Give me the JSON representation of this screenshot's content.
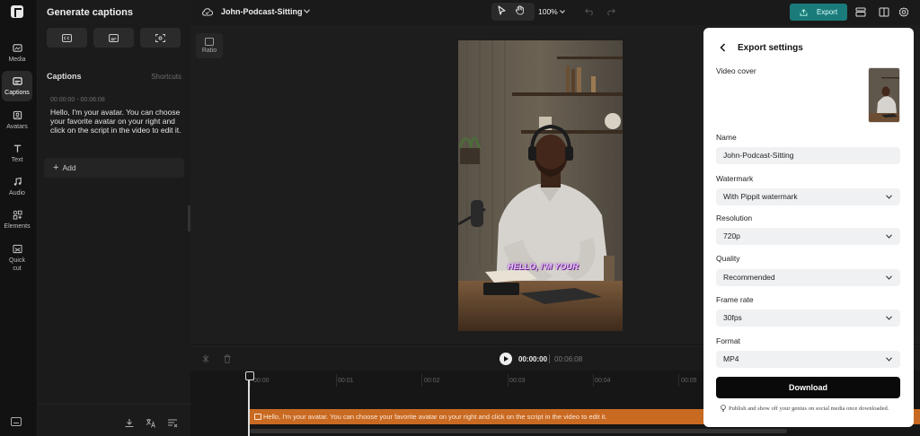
{
  "rail": {
    "items": [
      {
        "label": "Media",
        "icon": "media-icon"
      },
      {
        "label": "Captions",
        "icon": "captions-icon",
        "active": true
      },
      {
        "label": "Avatars",
        "icon": "avatars-icon"
      },
      {
        "label": "Text",
        "icon": "text-icon"
      },
      {
        "label": "Audio",
        "icon": "audio-icon"
      },
      {
        "label": "Elements",
        "icon": "elements-icon"
      },
      {
        "label": "Quick cut",
        "icon": "quick-cut-icon"
      }
    ]
  },
  "panel": {
    "title": "Generate captions",
    "captions_heading": "Captions",
    "shortcuts_label": "Shortcuts",
    "caption": {
      "time": "00:00:00 - 00:06:08",
      "text": "Hello, I'm your avatar. You can choose your favorite avatar on your right and click on the script in the video to edit it."
    },
    "add_label": "Add"
  },
  "topbar": {
    "project_title": "John-Podcast-Sitting",
    "zoom": "100%",
    "export_label": "Export"
  },
  "canvas": {
    "ratio_label": "Ratio",
    "video_caption": "HELLO, I'M YOUR"
  },
  "playback": {
    "current_time": "00:00:00",
    "total_time": "00:06:08"
  },
  "timeline": {
    "ticks": [
      "00:00",
      "00:01",
      "00:02",
      "00:03",
      "00:04",
      "00:05"
    ],
    "track_text": "Hello, I'm your avatar. You can choose your favorite avatar on your right and click on the script in the video to edit it."
  },
  "export_settings": {
    "title": "Export settings",
    "video_cover_label": "Video cover",
    "name_label": "Name",
    "name_value": "John-Podcast-Sitting",
    "watermark_label": "Watermark",
    "watermark_value": "With Pippit watermark",
    "resolution_label": "Resolution",
    "resolution_value": "720p",
    "quality_label": "Quality",
    "quality_value": "Recommended",
    "frame_rate_label": "Frame rate",
    "frame_rate_value": "30fps",
    "format_label": "Format",
    "format_value": "MP4",
    "download_label": "Download",
    "promo_text": "Publish and show off your genius on social media once downloaded."
  },
  "colors": {
    "accent_teal": "#1a7c7a",
    "caption_track": "#c96a22",
    "modal_bg": "#ffffff"
  }
}
